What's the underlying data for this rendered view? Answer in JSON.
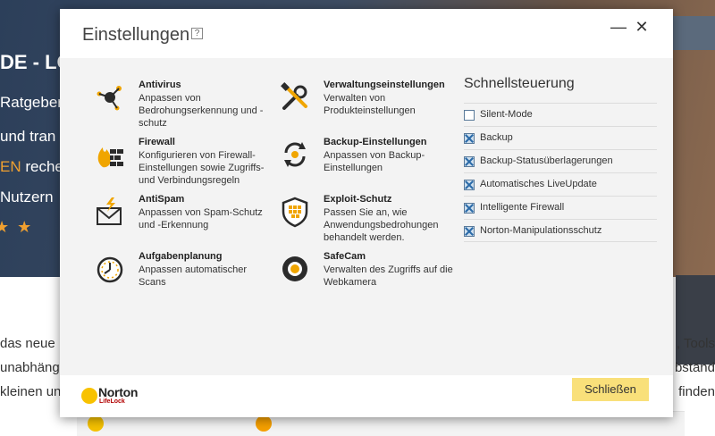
{
  "background": {
    "headline": "DE - LÖ",
    "line1": "Ratgeber",
    "line2": "und tran",
    "line3_accent": "EN",
    "line3_rest": " reche",
    "line4": "Nutzern",
    "stars": "★ ★",
    "text1": "das neue I",
    "text2": "unabhängi",
    "text3": "kleinen un",
    "right1": ", Tools",
    "right2": "bständ",
    "right3": "finden"
  },
  "dialog": {
    "title": "Einstellungen",
    "help": "?",
    "minimize": "—",
    "close": "✕",
    "settings": [
      {
        "title": "Antivirus",
        "desc": "Anpassen von Bedrohungserkennung und -schutz",
        "icon": "antivirus-icon"
      },
      {
        "title": "Firewall",
        "desc": "Konfigurieren von Firewall-Einstellungen sowie Zugriffs- und Verbindungsregeln",
        "icon": "firewall-icon"
      },
      {
        "title": "AntiSpam",
        "desc": "Anpassen von Spam-Schutz und -Erkennung",
        "icon": "antispam-icon"
      },
      {
        "title": "Aufgabenplanung",
        "desc": "Anpassen automatischer Scans",
        "icon": "clock-icon"
      },
      {
        "title": "Verwaltungseinstellungen",
        "desc": "Verwalten von Produkteinstellungen",
        "icon": "tools-icon"
      },
      {
        "title": "Backup-Einstellungen",
        "desc": "Anpassen von Backup-Einstellungen",
        "icon": "backup-icon"
      },
      {
        "title": "Exploit-Schutz",
        "desc": "Passen Sie an, wie Anwendungsbedrohungen behandelt werden.",
        "icon": "shield-icon"
      },
      {
        "title": "SafeCam",
        "desc": "Verwalten des Zugriffs auf die Webkamera",
        "icon": "webcam-icon"
      }
    ],
    "quick": {
      "title": "Schnellsteuerung",
      "items": [
        {
          "label": "Silent-Mode",
          "checked": false
        },
        {
          "label": "Backup",
          "checked": true
        },
        {
          "label": "Backup-Statusüberlagerungen",
          "checked": true
        },
        {
          "label": "Automatisches LiveUpdate",
          "checked": true
        },
        {
          "label": "Intelligente Firewall",
          "checked": true
        },
        {
          "label": "Norton-Manipulationsschutz",
          "checked": true
        }
      ]
    },
    "logo": {
      "name": "Norton",
      "sub": "LifeLock"
    },
    "close_button": "Schließen"
  }
}
